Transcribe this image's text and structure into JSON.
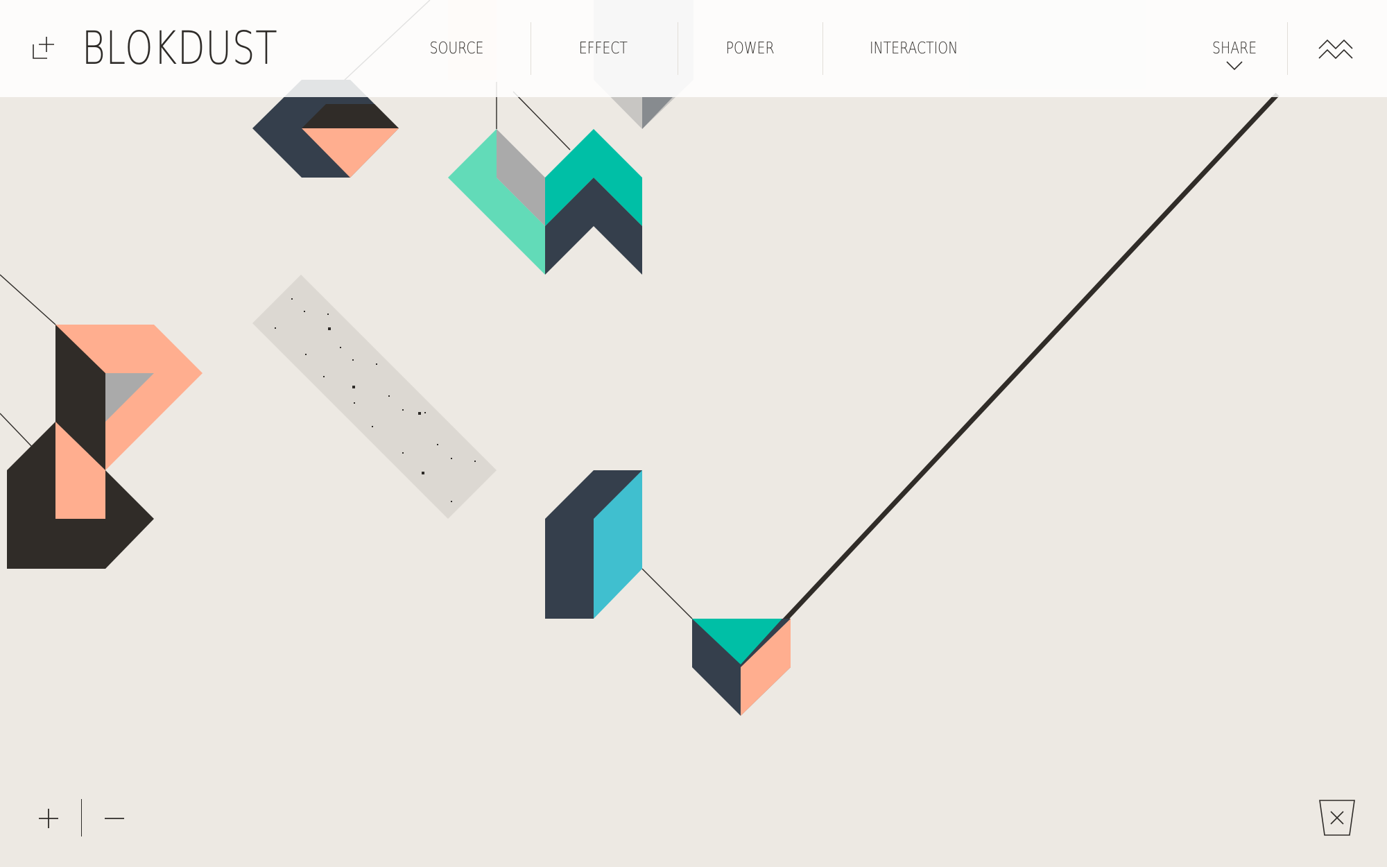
{
  "app": {
    "title": "BLOKDUST"
  },
  "nav": {
    "items": [
      {
        "label": "SOURCE"
      },
      {
        "label": "EFFECT"
      },
      {
        "label": "POWER"
      },
      {
        "label": "INTERACTION"
      }
    ],
    "share_label": "SHARE"
  },
  "icons": {
    "add_block": "add-block-icon",
    "share_chevron": "chevron-down-icon",
    "settings": "zigzag-menu-icon",
    "zoom_in": "plus-icon",
    "zoom_out": "minus-icon",
    "trash": "trash-bin-icon"
  },
  "colors": {
    "background": "#ede9e3",
    "dark_navy": "#353f4c",
    "black": "#302c28",
    "salmon": "#ffae8f",
    "teal": "#00bfa6",
    "mint": "#62dbb8",
    "sky": "#40bfcf",
    "grey": "#aaaaaa",
    "pale": "#dcd8d2"
  }
}
